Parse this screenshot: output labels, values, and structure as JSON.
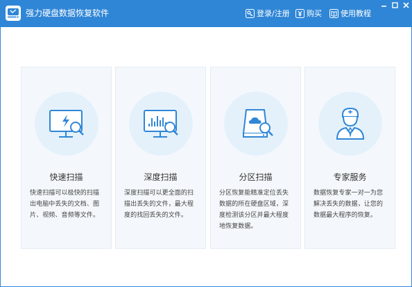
{
  "app": {
    "title": "强力硬盘数据恢复软件"
  },
  "titlebar": {
    "login_label": "登录/注册",
    "buy_label": "购买",
    "tutorial_label": "使用教程"
  },
  "colors": {
    "titlebar_bg": "#2f86d6",
    "card_bg": "#f4f8fc",
    "icon_circle_bg": "#e4f1fb",
    "icon_stroke": "#2f86d6"
  },
  "cards": [
    {
      "title": "快速扫描",
      "desc": "快速扫描可以极快的扫描出电脑中丢失的文档、图片、视频、音频等文件。",
      "icon": "monitor-lightning-magnifier-icon"
    },
    {
      "title": "深度扫描",
      "desc": "深度扫描可以更全面的扫描出丢失的文件，最大程度的找回丢失的文件。",
      "icon": "monitor-chart-magnifier-icon"
    },
    {
      "title": "分区扫描",
      "desc": "分区恢复能精准定位丢失数据的所在硬盘区域，深度检测该分区并最大程度地恢复数据。",
      "icon": "drive-cloud-magnifier-icon"
    },
    {
      "title": "专家服务",
      "desc": "数据恢复专家一对一为您解决丢失的数据，让您的数据最大程序的恢复。",
      "icon": "expert-person-icon"
    }
  ]
}
